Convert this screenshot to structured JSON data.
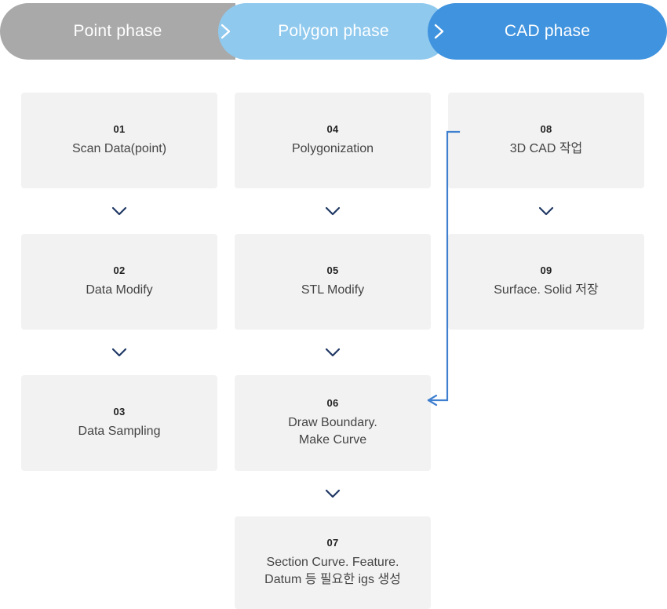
{
  "phases": [
    {
      "id": "point-phase",
      "label": "Point phase",
      "color": "#a9a9a9"
    },
    {
      "id": "polygon-phase",
      "label": "Polygon phase",
      "color": "#8fc9ee"
    },
    {
      "id": "cad-phase",
      "label": "CAD phase",
      "color": "#4093de"
    }
  ],
  "columns": [
    {
      "id": "point-column",
      "steps": [
        {
          "num": "01",
          "label": "Scan Data(point)"
        },
        {
          "num": "02",
          "label": "Data Modify"
        },
        {
          "num": "03",
          "label": "Data Sampling"
        }
      ]
    },
    {
      "id": "polygon-column",
      "steps": [
        {
          "num": "04",
          "label": "Polygonization"
        },
        {
          "num": "05",
          "label": "STL Modify"
        },
        {
          "num": "06",
          "label": "Draw Boundary.\nMake Curve"
        },
        {
          "num": "07",
          "label": "Section Curve. Feature.\nDatum 등 필요한 igs 생성"
        }
      ]
    },
    {
      "id": "cad-column",
      "steps": [
        {
          "num": "08",
          "label": "3D CAD 작업"
        },
        {
          "num": "09",
          "label": "Surface. Solid 저장"
        }
      ]
    }
  ],
  "connectors": {
    "feedback_color": "#3f7fd0",
    "down_arrow_color": "#1f3864"
  }
}
